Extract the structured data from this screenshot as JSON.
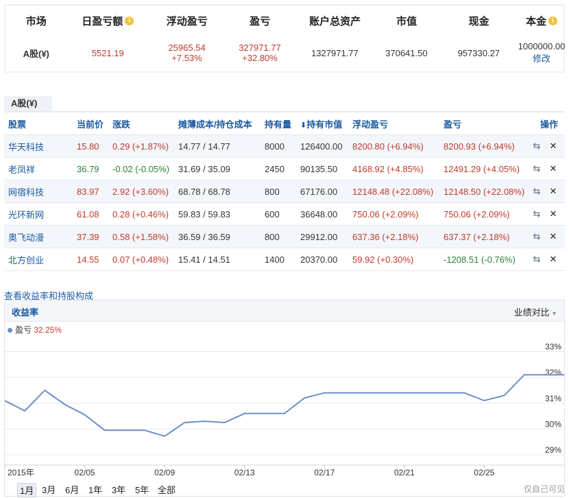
{
  "summary": {
    "headers": {
      "market": "市场",
      "daily_pnl": "日盈亏额",
      "float_pnl": "浮动盈亏",
      "pnl": "盈亏",
      "total_assets": "账户总资产",
      "market_value": "市值",
      "cash": "现金",
      "principal": "本金"
    },
    "row": {
      "market": "A股(¥)",
      "daily_pnl": "5521.19",
      "float_pnl": "25965.54",
      "float_pnl_pct": "+7.53%",
      "pnl": "327971.77",
      "pnl_pct": "+32.80%",
      "total_assets": "1327971.77",
      "market_value": "370641.50",
      "cash": "957330.27",
      "principal": "1000000.00",
      "edit": "修改"
    },
    "info_icon": "i"
  },
  "tab": "A股(¥)",
  "table": {
    "columns": [
      "股票",
      "当前价",
      "涨跌",
      "摊薄成本/持仓成本",
      "持有量",
      "持有市值",
      "浮动盈亏",
      "盈亏",
      "操作"
    ],
    "sort_icon": "sort-desc-icon",
    "rows": [
      {
        "name": "华天科技",
        "price": "15.80",
        "change": "0.29 (+1.87%)",
        "cost": "14.77 / 14.77",
        "qty": "8000",
        "mv": "126400.00",
        "float": "8200.80 (+6.94%)",
        "pnl": "8200.93 (+6.94%)",
        "price_c": "red",
        "change_c": "red",
        "pnl_c": "red"
      },
      {
        "name": "老凤祥",
        "price": "36.79",
        "change": "-0.02 (-0.05%)",
        "cost": "31.69 / 35.09",
        "qty": "2450",
        "mv": "90135.50",
        "float": "4168.92 (+4.85%)",
        "pnl": "12491.29 (+4.05%)",
        "price_c": "green",
        "change_c": "green",
        "pnl_c": "red"
      },
      {
        "name": "网宿科技",
        "price": "83.97",
        "change": "2.92 (+3.60%)",
        "cost": "68.78 / 68.78",
        "qty": "800",
        "mv": "67176.00",
        "float": "12148.48 (+22.08%)",
        "pnl": "12148.50 (+22.08%)",
        "price_c": "red",
        "change_c": "red",
        "pnl_c": "red"
      },
      {
        "name": "光环新网",
        "price": "61.08",
        "change": "0.28 (+0.46%)",
        "cost": "59.83 / 59.83",
        "qty": "600",
        "mv": "36648.00",
        "float": "750.06 (+2.09%)",
        "pnl": "750.06 (+2.09%)",
        "price_c": "red",
        "change_c": "red",
        "pnl_c": "red"
      },
      {
        "name": "奥飞动漫",
        "price": "37.39",
        "change": "0.58 (+1.58%)",
        "cost": "36.59 / 36.59",
        "qty": "800",
        "mv": "29912.00",
        "float": "637.36 (+2.18%)",
        "pnl": "637.37 (+2.18%)",
        "price_c": "red",
        "change_c": "red",
        "pnl_c": "red"
      },
      {
        "name": "北方创业",
        "price": "14.55",
        "change": "0.07 (+0.48%)",
        "cost": "15.41 / 14.51",
        "qty": "1400",
        "mv": "20370.00",
        "float": "59.92 (+0.30%)",
        "pnl": "-1208.51 (-0.76%)",
        "price_c": "red",
        "change_c": "red",
        "pnl_c": "green"
      }
    ]
  },
  "chart_link": "查看收益率和持股构成",
  "chart_panel": {
    "title": "收益率",
    "compare": "业绩对比",
    "legend_name": "盈亏",
    "legend_value": "32.25%",
    "ranges": [
      "1月",
      "3月",
      "6月",
      "1年",
      "3年",
      "5年",
      "全部"
    ],
    "selected_range": "1月"
  },
  "watermark": "仅自己可见",
  "chart_data": {
    "type": "line",
    "title": "收益率",
    "series": [
      {
        "name": "盈亏",
        "color": "#6a8fc7",
        "values": [
          31.1,
          30.7,
          31.5,
          30.95,
          30.55,
          29.95,
          29.95,
          29.95,
          29.72,
          30.25,
          30.3,
          30.25,
          30.6,
          30.6,
          30.6,
          31.2,
          31.4,
          31.4,
          31.4,
          31.4,
          31.4,
          31.4,
          31.4,
          31.4,
          31.1,
          31.3,
          32.1,
          32.1,
          32.1
        ]
      }
    ],
    "x_tick_labels": [
      "2015年",
      "02/05",
      "02/09",
      "02/13",
      "02/17",
      "02/21",
      "02/25"
    ],
    "x_tick_index": [
      0,
      4,
      8,
      12,
      16,
      20,
      24
    ],
    "y_ticks": [
      "29%",
      "30%",
      "31%",
      "32%",
      "33%"
    ],
    "ylim": [
      28.6,
      33.6
    ],
    "grid": true
  }
}
